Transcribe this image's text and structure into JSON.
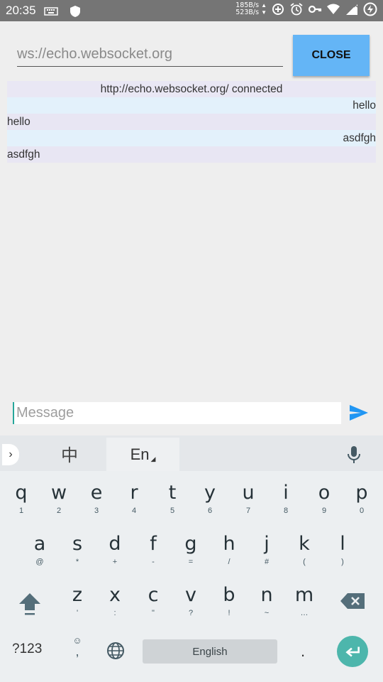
{
  "status_bar": {
    "time": "20:35",
    "net_up": "185B/s",
    "net_down": "523B/s",
    "icons": [
      "keyboard-icon",
      "shield-icon",
      "data-saver-icon",
      "alarm-icon",
      "key-icon",
      "wifi-icon",
      "signal-icon",
      "battery-charging-icon"
    ]
  },
  "connection": {
    "url_placeholder": "ws://echo.websocket.org",
    "close_label": "CLOSE"
  },
  "messages": [
    {
      "text": "http://echo.websocket.org/ connected",
      "align": "center"
    },
    {
      "text": "hello",
      "align": "right"
    },
    {
      "text": "hello",
      "align": "left"
    },
    {
      "text": "asdfgh",
      "align": "right"
    },
    {
      "text": "asdfgh",
      "align": "left"
    }
  ],
  "compose": {
    "placeholder": "Message",
    "accent": "#2196f3"
  },
  "keyboard": {
    "lang_zh": "中",
    "lang_en": "En",
    "rows": [
      [
        [
          "q",
          "1"
        ],
        [
          "w",
          "2"
        ],
        [
          "e",
          "3"
        ],
        [
          "r",
          "4"
        ],
        [
          "t",
          "5"
        ],
        [
          "y",
          "6"
        ],
        [
          "u",
          "7"
        ],
        [
          "i",
          "8"
        ],
        [
          "o",
          "9"
        ],
        [
          "p",
          "0"
        ]
      ],
      [
        [
          "a",
          "@"
        ],
        [
          "s",
          "*"
        ],
        [
          "d",
          "+"
        ],
        [
          "f",
          "-"
        ],
        [
          "g",
          "="
        ],
        [
          "h",
          "/"
        ],
        [
          "j",
          "#"
        ],
        [
          "k",
          "("
        ],
        [
          "l",
          ")"
        ]
      ],
      [
        [
          "z",
          "'"
        ],
        [
          "x",
          ":"
        ],
        [
          "c",
          "\""
        ],
        [
          "v",
          "?"
        ],
        [
          "b",
          "!"
        ],
        [
          "n",
          "~"
        ],
        [
          "m",
          "…"
        ]
      ]
    ],
    "num_label": "?123",
    "emoji_label": "☺",
    "comma_label": ",",
    "space_label": "English",
    "period_label": ".",
    "enter_color": "#4db6ac"
  }
}
